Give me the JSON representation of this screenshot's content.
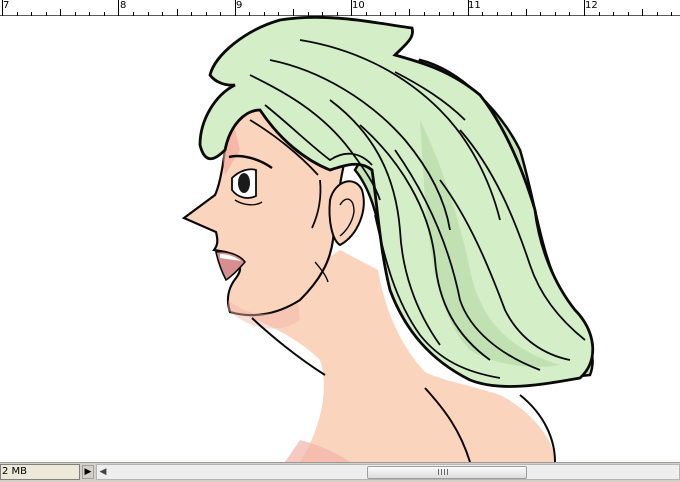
{
  "ruler": {
    "labels": [
      "7",
      "8",
      "9",
      "10",
      "11",
      "12"
    ]
  },
  "canvas": {
    "content": "manga-style side profile illustration",
    "colors": {
      "hair": "#d4eec7",
      "hair_shade": "#b9dcaa",
      "skin": "#fbd4bd",
      "skin_shade": "#f2a59a",
      "outline": "#0a0a0a"
    }
  },
  "statusbar": {
    "doc_size": "2 MB",
    "menu_arrow_icon": "triangle-right-icon",
    "scroll_left_icon": "triangle-left-icon"
  }
}
